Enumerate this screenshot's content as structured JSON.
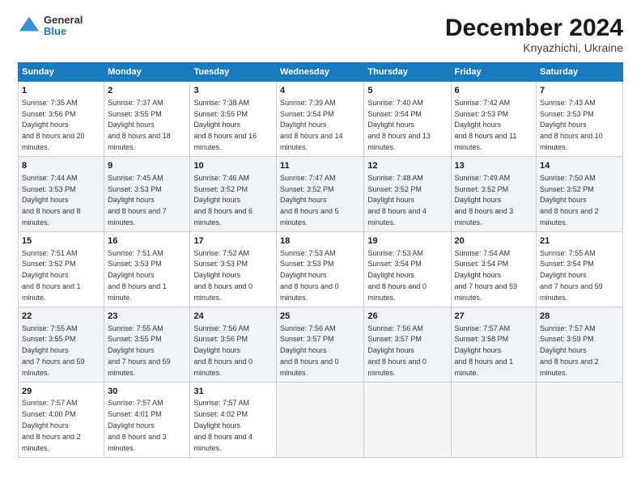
{
  "header": {
    "logo_line1": "General",
    "logo_line2": "Blue",
    "title": "December 2024",
    "subtitle": "Knyazhichi, Ukraine"
  },
  "days_of_week": [
    "Sunday",
    "Monday",
    "Tuesday",
    "Wednesday",
    "Thursday",
    "Friday",
    "Saturday"
  ],
  "weeks": [
    [
      {
        "day": "1",
        "sunrise": "7:35 AM",
        "sunset": "3:56 PM",
        "daylight": "8 hours and 20 minutes."
      },
      {
        "day": "2",
        "sunrise": "7:37 AM",
        "sunset": "3:55 PM",
        "daylight": "8 hours and 18 minutes."
      },
      {
        "day": "3",
        "sunrise": "7:38 AM",
        "sunset": "3:55 PM",
        "daylight": "8 hours and 16 minutes."
      },
      {
        "day": "4",
        "sunrise": "7:39 AM",
        "sunset": "3:54 PM",
        "daylight": "8 hours and 14 minutes."
      },
      {
        "day": "5",
        "sunrise": "7:40 AM",
        "sunset": "3:54 PM",
        "daylight": "8 hours and 13 minutes."
      },
      {
        "day": "6",
        "sunrise": "7:42 AM",
        "sunset": "3:53 PM",
        "daylight": "8 hours and 11 minutes."
      },
      {
        "day": "7",
        "sunrise": "7:43 AM",
        "sunset": "3:53 PM",
        "daylight": "8 hours and 10 minutes."
      }
    ],
    [
      {
        "day": "8",
        "sunrise": "7:44 AM",
        "sunset": "3:53 PM",
        "daylight": "8 hours and 8 minutes."
      },
      {
        "day": "9",
        "sunrise": "7:45 AM",
        "sunset": "3:53 PM",
        "daylight": "8 hours and 7 minutes."
      },
      {
        "day": "10",
        "sunrise": "7:46 AM",
        "sunset": "3:52 PM",
        "daylight": "8 hours and 6 minutes."
      },
      {
        "day": "11",
        "sunrise": "7:47 AM",
        "sunset": "3:52 PM",
        "daylight": "8 hours and 5 minutes."
      },
      {
        "day": "12",
        "sunrise": "7:48 AM",
        "sunset": "3:52 PM",
        "daylight": "8 hours and 4 minutes."
      },
      {
        "day": "13",
        "sunrise": "7:49 AM",
        "sunset": "3:52 PM",
        "daylight": "8 hours and 3 minutes."
      },
      {
        "day": "14",
        "sunrise": "7:50 AM",
        "sunset": "3:52 PM",
        "daylight": "8 hours and 2 minutes."
      }
    ],
    [
      {
        "day": "15",
        "sunrise": "7:51 AM",
        "sunset": "3:52 PM",
        "daylight": "8 hours and 1 minute."
      },
      {
        "day": "16",
        "sunrise": "7:51 AM",
        "sunset": "3:53 PM",
        "daylight": "8 hours and 1 minute."
      },
      {
        "day": "17",
        "sunrise": "7:52 AM",
        "sunset": "3:53 PM",
        "daylight": "8 hours and 0 minutes."
      },
      {
        "day": "18",
        "sunrise": "7:53 AM",
        "sunset": "3:53 PM",
        "daylight": "8 hours and 0 minutes."
      },
      {
        "day": "19",
        "sunrise": "7:53 AM",
        "sunset": "3:54 PM",
        "daylight": "8 hours and 0 minutes."
      },
      {
        "day": "20",
        "sunrise": "7:54 AM",
        "sunset": "3:54 PM",
        "daylight": "7 hours and 59 minutes."
      },
      {
        "day": "21",
        "sunrise": "7:55 AM",
        "sunset": "3:54 PM",
        "daylight": "7 hours and 59 minutes."
      }
    ],
    [
      {
        "day": "22",
        "sunrise": "7:55 AM",
        "sunset": "3:55 PM",
        "daylight": "7 hours and 59 minutes."
      },
      {
        "day": "23",
        "sunrise": "7:55 AM",
        "sunset": "3:55 PM",
        "daylight": "7 hours and 59 minutes."
      },
      {
        "day": "24",
        "sunrise": "7:56 AM",
        "sunset": "3:56 PM",
        "daylight": "8 hours and 0 minutes."
      },
      {
        "day": "25",
        "sunrise": "7:56 AM",
        "sunset": "3:57 PM",
        "daylight": "8 hours and 0 minutes."
      },
      {
        "day": "26",
        "sunrise": "7:56 AM",
        "sunset": "3:57 PM",
        "daylight": "8 hours and 0 minutes."
      },
      {
        "day": "27",
        "sunrise": "7:57 AM",
        "sunset": "3:58 PM",
        "daylight": "8 hours and 1 minute."
      },
      {
        "day": "28",
        "sunrise": "7:57 AM",
        "sunset": "3:59 PM",
        "daylight": "8 hours and 2 minutes."
      }
    ],
    [
      {
        "day": "29",
        "sunrise": "7:57 AM",
        "sunset": "4:00 PM",
        "daylight": "8 hours and 2 minutes."
      },
      {
        "day": "30",
        "sunrise": "7:57 AM",
        "sunset": "4:01 PM",
        "daylight": "8 hours and 3 minutes."
      },
      {
        "day": "31",
        "sunrise": "7:57 AM",
        "sunset": "4:02 PM",
        "daylight": "8 hours and 4 minutes."
      },
      null,
      null,
      null,
      null
    ]
  ]
}
